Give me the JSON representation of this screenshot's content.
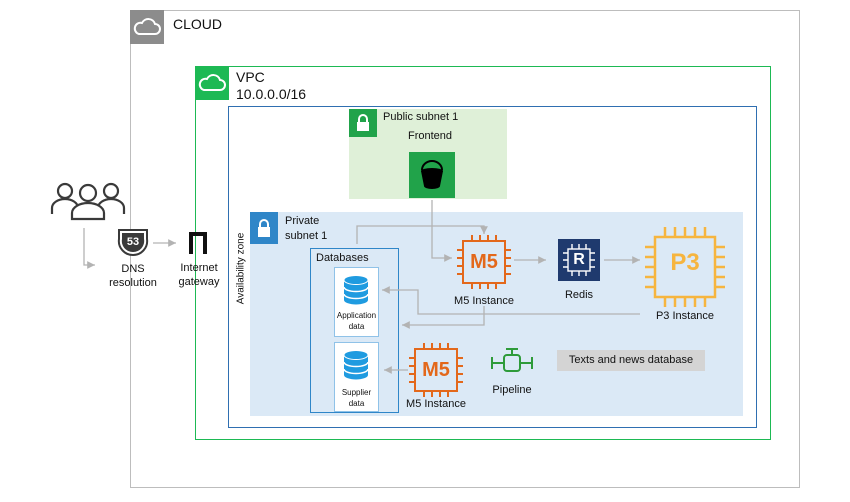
{
  "cloud": {
    "label": "CLOUD"
  },
  "vpc": {
    "label": "VPC",
    "cidr": "10.0.0.0/16"
  },
  "availability_zone": {
    "label": "Availability zone"
  },
  "public_subnet": {
    "label": "Public subnet 1",
    "frontend": "Frontend"
  },
  "private_subnet": {
    "label_line1": "Private",
    "label_line2": "subnet 1"
  },
  "databases": {
    "title": "Databases",
    "app_line1": "Application",
    "app_line2": "data",
    "sup_line1": "Supplier",
    "sup_line2": "data"
  },
  "users": {
    "icon": "users-icon"
  },
  "dns": {
    "badge": "53",
    "line1": "DNS",
    "line2": "resolution"
  },
  "gateway": {
    "line1": "Internet",
    "line2": "gateway"
  },
  "m5_top": {
    "chip": "M5",
    "label": "M5 Instance"
  },
  "m5_bottom": {
    "chip": "M5",
    "label": "M5 Instance"
  },
  "redis": {
    "chip": "R",
    "label": "Redis"
  },
  "p3": {
    "chip": "P3",
    "label": "P3 Instance"
  },
  "pipeline": {
    "label": "Pipeline"
  },
  "texts_db": {
    "label": "Texts and news database"
  },
  "colors": {
    "cloud_gray": "#8c8c8c",
    "vpc_green": "#1db954",
    "subnet_blue": "#2f6fb1",
    "private_fill": "#dbe9f6",
    "public_fill": "#dff0d8",
    "lock_green": "#21a34a",
    "lock_blue": "#2f86c8",
    "db_blue": "#1f9be0",
    "m5_orange": "#e3681b",
    "p3_yellow": "#f6b53f",
    "redis_navy": "#1f3a6e",
    "pipeline_green": "#2e9b3a",
    "arrow_gray": "#b3b3b3"
  }
}
